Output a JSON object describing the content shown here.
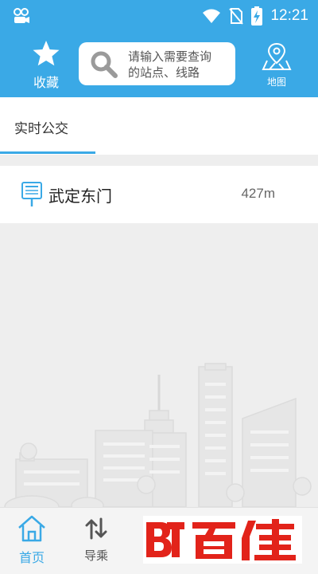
{
  "status_bar": {
    "time": "12:21"
  },
  "header": {
    "favorites_label": "收藏",
    "search_placeholder": "请输入需要查询\n的站点、线路",
    "map_label": "地图"
  },
  "tabs": [
    {
      "label": "实时公交",
      "active": true
    }
  ],
  "stations": [
    {
      "name": "武定东门",
      "distance": "427m"
    }
  ],
  "bottom_nav": {
    "home_label": "首页",
    "guide_label": "导乘",
    "brand_text": "百佳"
  },
  "colors": {
    "accent": "#3aa9e6",
    "brand": "#e2231a"
  }
}
